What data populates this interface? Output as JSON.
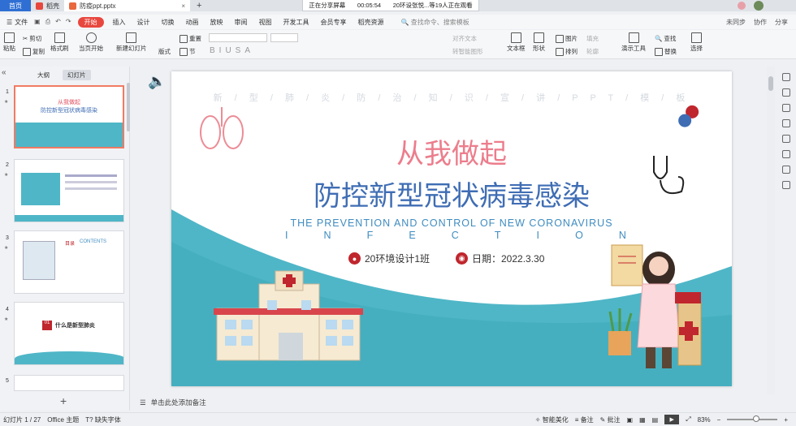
{
  "titlebar": {
    "home_tab": "首页",
    "tabs": [
      {
        "label": "稻壳",
        "color": "#e8473e"
      },
      {
        "label": "防疫ppt.pptx",
        "color": "#e8693e",
        "close": "×"
      }
    ],
    "new_tab": "+",
    "share": {
      "status": "正在分享屏幕",
      "time": "00:05:54",
      "viewers": "20环设张悦...等19人正在观看"
    }
  },
  "menu": {
    "file": "文件",
    "items": [
      "开始",
      "插入",
      "设计",
      "切换",
      "动画",
      "放映",
      "审阅",
      "视图",
      "开发工具",
      "会员专享",
      "稻壳资源"
    ],
    "search_placeholder": "查找命令、搜索模板",
    "right": [
      "未同步",
      "协作",
      "分享"
    ]
  },
  "ribbon": {
    "paste": "粘贴",
    "cut": "剪切",
    "copy": "复制",
    "format_painter": "格式刷",
    "from_current": "当页开始",
    "new_slide": "新建幻灯片",
    "layout": "版式",
    "section": "节",
    "reset": "重置",
    "align_text": "对齐文本",
    "convert_smartart": "转智能图形",
    "textbox": "文本框",
    "shape": "形状",
    "arrange": "排列",
    "picture": "图片",
    "fill": "填充",
    "outline": "轮廓",
    "slideshow_tools": "演示工具",
    "find": "查找",
    "replace": "替换",
    "select": "选择"
  },
  "left_panel": {
    "tabs": [
      "大纲",
      "幻灯片"
    ],
    "active_tab": "幻灯片",
    "thumbnails": [
      {
        "num": "1",
        "title_a": "从我做起",
        "title_b": "防控新型冠状病毒感染"
      },
      {
        "num": "2",
        "title_a": "",
        "title_b": ""
      },
      {
        "num": "3",
        "title_a": "目录",
        "title_b": "CONTENTS"
      },
      {
        "num": "4",
        "title_a": "01",
        "title_b": "什么是新型肺炎"
      },
      {
        "num": "5",
        "title_a": "",
        "title_b": ""
      }
    ],
    "add_label": "+"
  },
  "slide": {
    "header_line": "新 / 型 / 肺 / 炎 / 防 / 治 / 知 / 识 / 宣 / 讲 / P P T / 模 / 板",
    "title_cn1": "从我做起",
    "title_cn2": "防控新型冠状病毒感染",
    "title_en1": "THE PREVENTION AND CONTROL OF NEW CORONAVIRUS",
    "title_en2_letters": [
      "I",
      "N",
      "F",
      "E",
      "C",
      "T",
      "I",
      "O",
      "N"
    ],
    "class_label": "20环境设计1班",
    "date_label": "日期：2022.3.30",
    "colors": {
      "pink": "#ec7d8c",
      "blue": "#3f6db4",
      "teal": "#4fb6c7",
      "red": "#c0262d"
    }
  },
  "notes_placeholder": "单击此处添加备注",
  "status": {
    "slide_pos": "幻灯片 1 / 27",
    "theme": "Office 主题",
    "missing_font": "缺失字体",
    "smart_beautify": "智能美化",
    "notes": "备注",
    "comment": "批注",
    "zoom": "83%"
  }
}
